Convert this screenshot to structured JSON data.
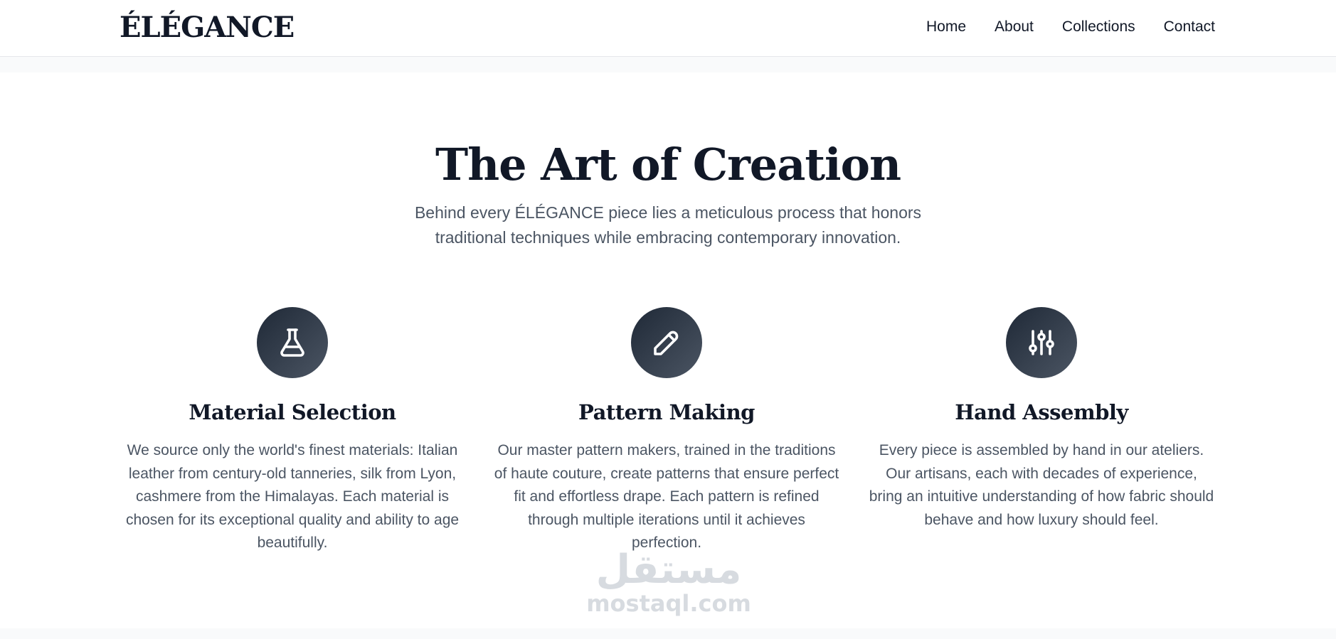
{
  "header": {
    "logo": "ÉLÉGANCE",
    "nav": [
      {
        "label": "Home"
      },
      {
        "label": "About"
      },
      {
        "label": "Collections"
      },
      {
        "label": "Contact"
      }
    ]
  },
  "section": {
    "title": "The Art of Creation",
    "subtitle": "Behind every ÉLÉGANCE piece lies a meticulous process that honors traditional techniques while embracing contemporary innovation.",
    "steps": [
      {
        "icon": "flask-icon",
        "title": "Material Selection",
        "description": "We source only the world's finest materials: Italian leather from century-old tanneries, silk from Lyon, cashmere from the Himalayas. Each material is chosen for its exceptional quality and ability to age beautifully."
      },
      {
        "icon": "pencil-icon",
        "title": "Pattern Making",
        "description": "Our master pattern makers, trained in the traditions of haute couture, create patterns that ensure perfect fit and effortless drape. Each pattern is refined through multiple iterations until it achieves perfection."
      },
      {
        "icon": "sliders-icon",
        "title": "Hand Assembly",
        "description": "Every piece is assembled by hand in our ateliers. Our artisans, each with decades of experience, bring an intuitive understanding of how fabric should behave and how luxury should feel."
      }
    ]
  },
  "watermark": {
    "arabic": "مستقل",
    "latin": "mostaql.com"
  },
  "colors": {
    "text_primary": "#111827",
    "text_secondary": "#4b5563",
    "icon_gradient_start": "#1f2937",
    "icon_gradient_end": "#4b5563",
    "band": "#f9fafb"
  }
}
